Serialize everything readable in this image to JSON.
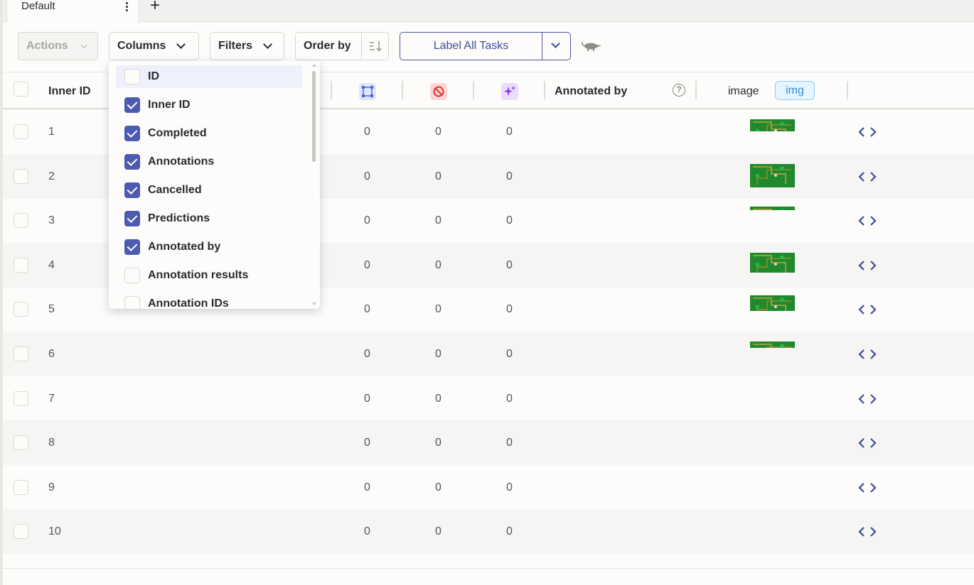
{
  "tabs": [
    {
      "label": "Default"
    }
  ],
  "toolbar": {
    "actions_label": "Actions",
    "columns_label": "Columns",
    "filters_label": "Filters",
    "order_label": "Order by",
    "label_all_label": "Label All Tasks"
  },
  "header": {
    "inner_id": "Inner ID",
    "annotated_by": "Annotated by",
    "image": "image",
    "image_badge": "img",
    "help_glyph": "?"
  },
  "icons": {
    "annotations": "annotations-icon",
    "cancelled": "cancelled-icon",
    "predictions": "predictions-icon",
    "code": "code-icon"
  },
  "colors": {
    "accent": "#4c5ab0",
    "annotations_icon": "#4a6ad6",
    "cancelled_icon": "#e02b2b",
    "predictions_icon": "#8b3fe0"
  },
  "rows": [
    {
      "inner_id": "1",
      "annotations": "0",
      "cancelled": "0",
      "predictions": "0",
      "has_image": true
    },
    {
      "inner_id": "2",
      "annotations": "0",
      "cancelled": "0",
      "predictions": "0",
      "has_image": true
    },
    {
      "inner_id": "3",
      "annotations": "0",
      "cancelled": "0",
      "predictions": "0",
      "has_image": true
    },
    {
      "inner_id": "4",
      "annotations": "0",
      "cancelled": "0",
      "predictions": "0",
      "has_image": true
    },
    {
      "inner_id": "5",
      "annotations": "0",
      "cancelled": "0",
      "predictions": "0",
      "has_image": true
    },
    {
      "inner_id": "6",
      "annotations": "0",
      "cancelled": "0",
      "predictions": "0",
      "has_image": true
    },
    {
      "inner_id": "7",
      "annotations": "0",
      "cancelled": "0",
      "predictions": "0",
      "has_image": false
    },
    {
      "inner_id": "8",
      "annotations": "0",
      "cancelled": "0",
      "predictions": "0",
      "has_image": false
    },
    {
      "inner_id": "9",
      "annotations": "0",
      "cancelled": "0",
      "predictions": "0",
      "has_image": false
    },
    {
      "inner_id": "10",
      "annotations": "0",
      "cancelled": "0",
      "predictions": "0",
      "has_image": false
    }
  ],
  "columns_menu": [
    {
      "label": "ID",
      "checked": false,
      "highlighted": true
    },
    {
      "label": "Inner ID",
      "checked": true
    },
    {
      "label": "Completed",
      "checked": true
    },
    {
      "label": "Annotations",
      "checked": true
    },
    {
      "label": "Cancelled",
      "checked": true
    },
    {
      "label": "Predictions",
      "checked": true
    },
    {
      "label": "Annotated by",
      "checked": true
    },
    {
      "label": "Annotation results",
      "checked": false
    },
    {
      "label": "Annotation IDs",
      "checked": false
    }
  ]
}
